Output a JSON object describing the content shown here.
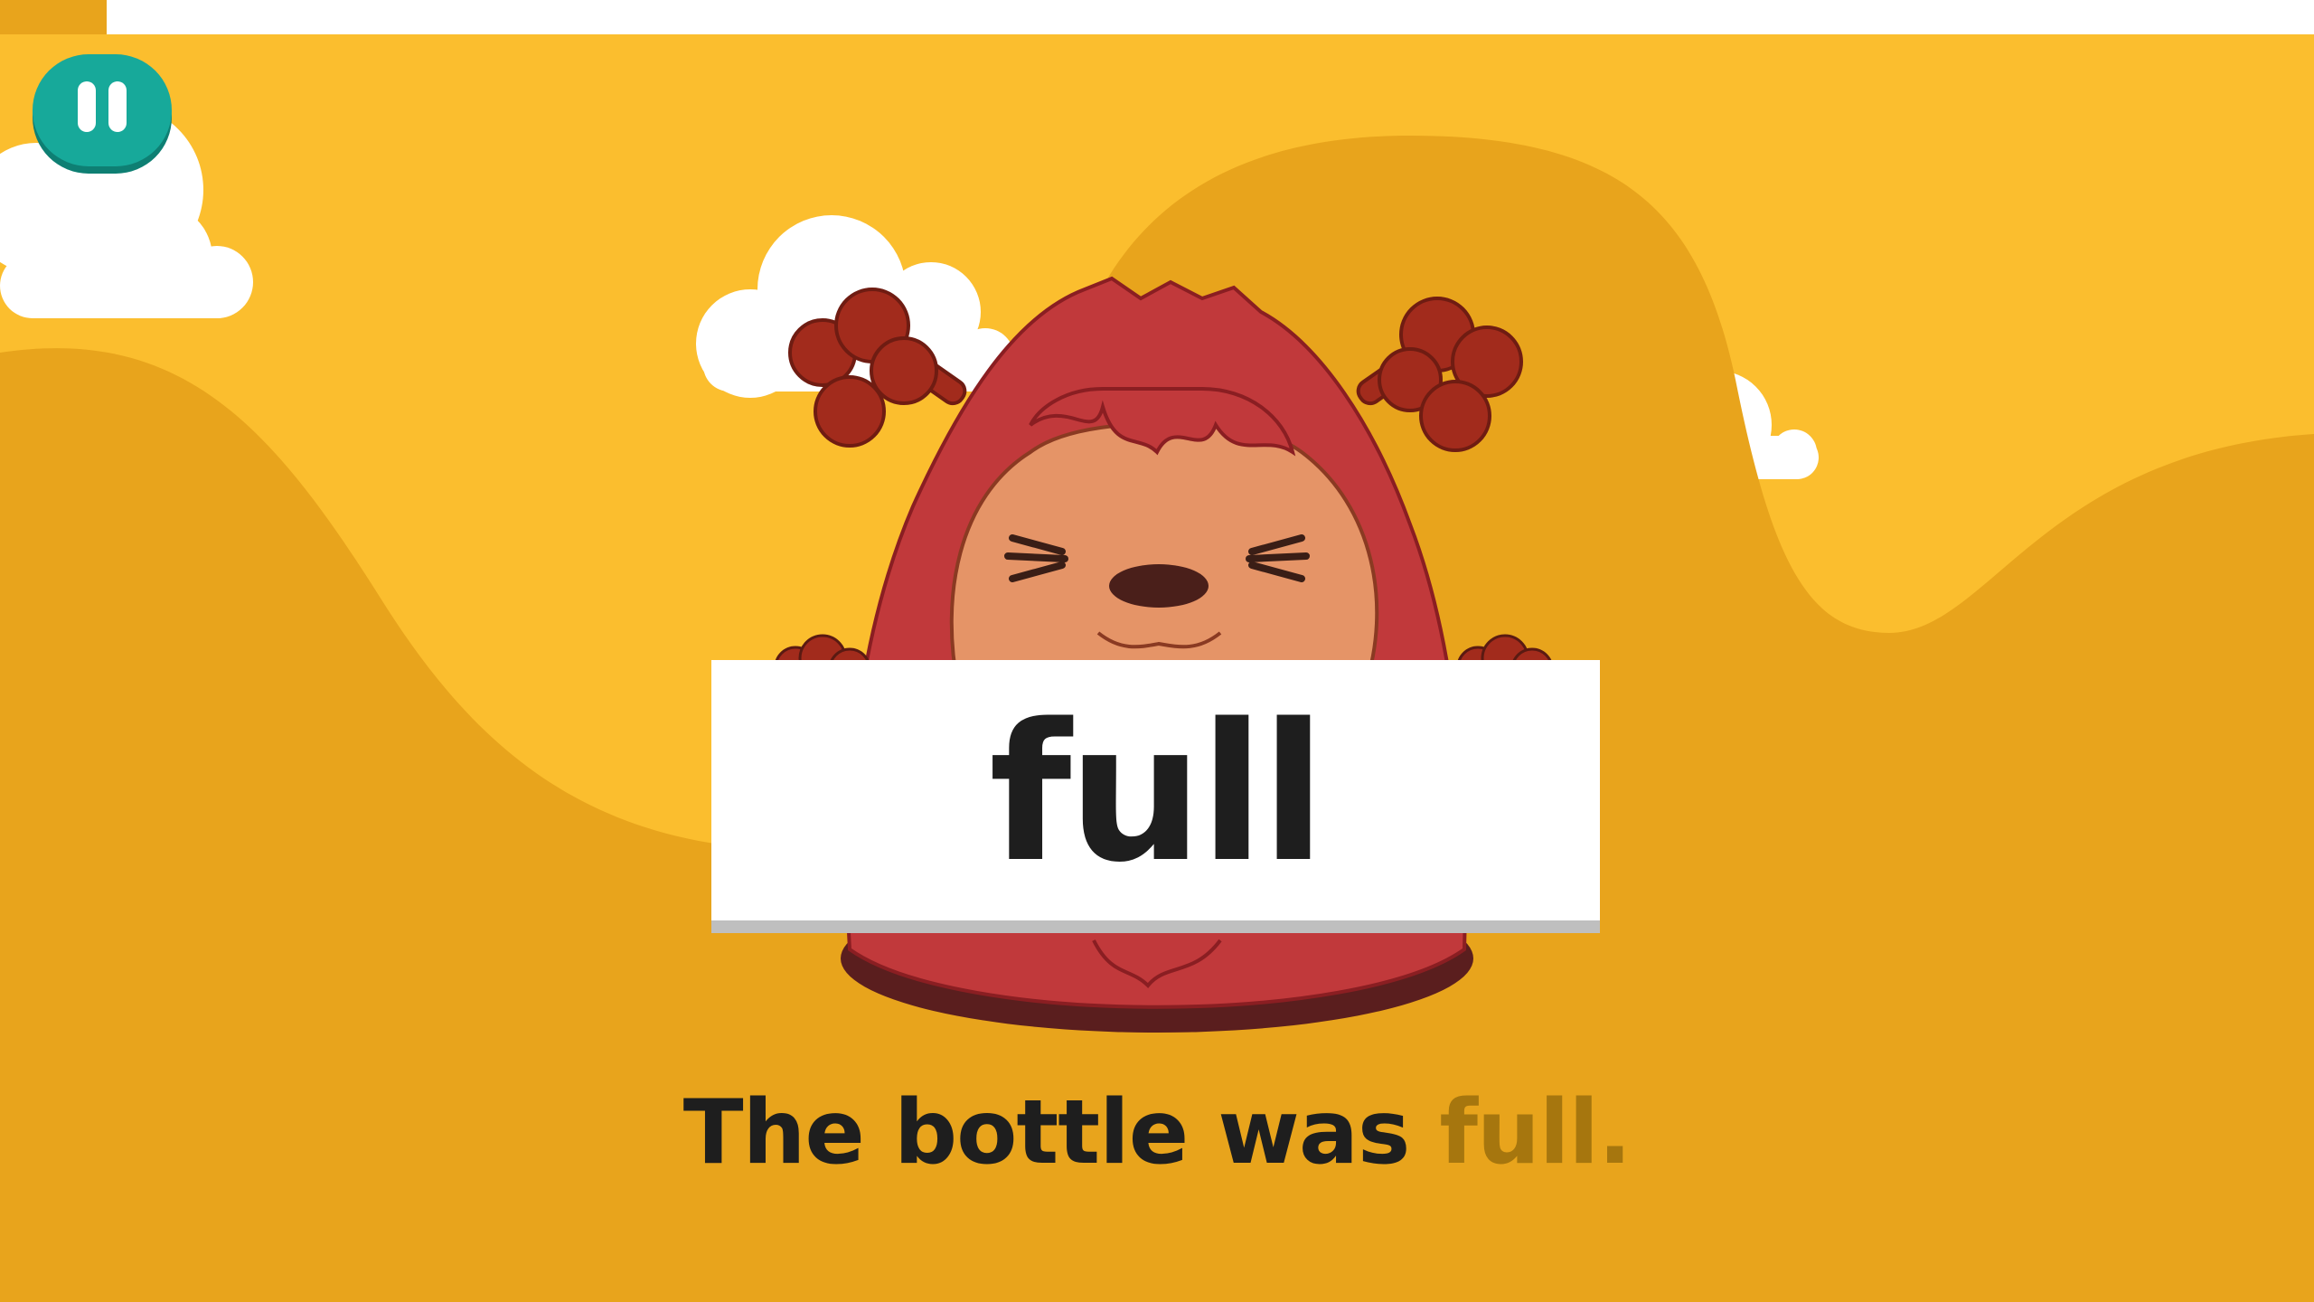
{
  "progress": {
    "value": 0.046
  },
  "pause_button": {
    "icon": "pause-icon"
  },
  "character": {
    "name_icon": "red-furry-monster-holding-sign"
  },
  "sign": {
    "word": "full"
  },
  "sentence": {
    "prefix": "The bottle was ",
    "highlight": "full."
  },
  "colors": {
    "sky": "#FBBE2E",
    "hill": "#E8A41C",
    "accent_teal": "#17A99A",
    "monster_red": "#C1393B",
    "monster_face": "#E59467",
    "highlight_text": "#A6760E"
  }
}
